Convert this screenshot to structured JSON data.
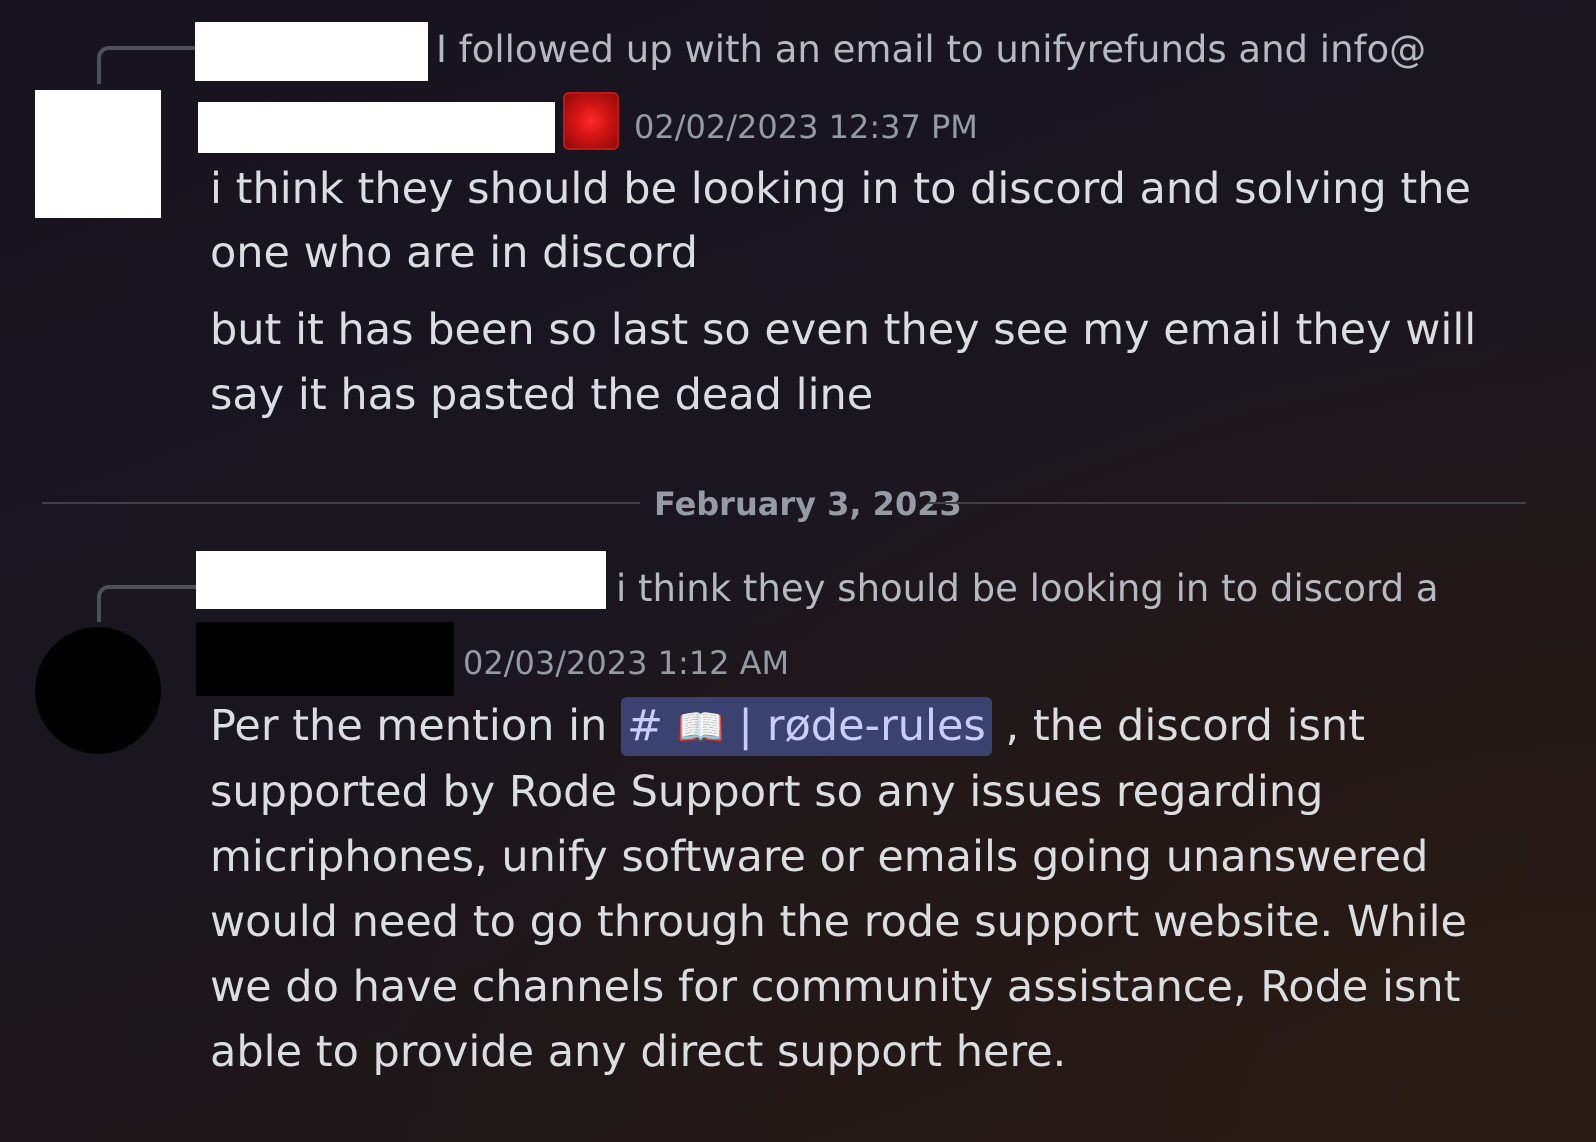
{
  "message1": {
    "reply_preview": "I followed up with an email to unifyrefunds and info@rode",
    "timestamp": "02/02/2023 12:37 PM",
    "lines": [
      "i think they should be looking in to discord and solving the",
      "one who are in discord"
    ],
    "lines2": [
      "but it has been so last so even they see my email they will",
      "say it has pasted the dead line"
    ],
    "role_color": "#e01e1e"
  },
  "date_divider": {
    "label": "February 3, 2023"
  },
  "message2": {
    "reply_preview": "i think they should be looking in to discord and",
    "timestamp": "02/03/2023 1:12 AM",
    "line1_prefix": "Per the mention in",
    "channel_mention": {
      "hash": "#",
      "emoji": "📖",
      "separator": "|",
      "name": "røde-rules"
    },
    "line1_suffix": ", the discord isnt",
    "lines": [
      "supported by Rode Support so any issues regarding",
      "micriphones, unify software or emails going unanswered",
      "would need to go through the rode support website. While",
      "we do have channels for community assistance, Rode isnt",
      "able to provide any direct support here."
    ]
  }
}
